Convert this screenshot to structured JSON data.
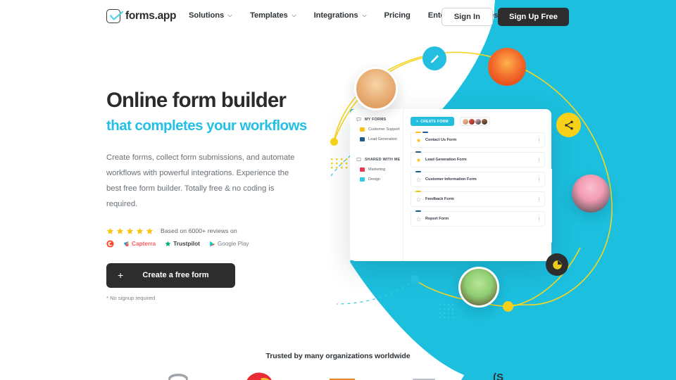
{
  "brand": {
    "name": "forms.app",
    "logo_icon": "form-check-icon",
    "accent_cyan": "#23C0E4",
    "accent_yellow": "#F7D117",
    "dark": "#2d2d2d"
  },
  "header": {
    "nav_items": [
      {
        "label": "Solutions",
        "has_dropdown": true,
        "icon": "chevron-down-icon"
      },
      {
        "label": "Templates",
        "has_dropdown": true,
        "icon": "chevron-down-icon"
      },
      {
        "label": "Integrations",
        "has_dropdown": true,
        "icon": "chevron-down-icon"
      },
      {
        "label": "Pricing",
        "has_dropdown": false,
        "icon": ""
      },
      {
        "label": "Enterprise",
        "has_dropdown": false,
        "icon": ""
      },
      {
        "label": "Resources",
        "has_dropdown": true,
        "icon": "chevron-down-icon"
      }
    ],
    "sign_in": "Sign In",
    "sign_up": "Sign Up Free"
  },
  "hero": {
    "title": "Online form builder",
    "subtitle": "that completes your workflows",
    "description": "Create forms, collect form submissions, and automate workflows with powerful integrations. Experience the best free form builder. Totally free & no coding is required.",
    "reviews_text": "Based on 6000+ reviews on",
    "stars": 5,
    "review_badges": [
      {
        "label": "G2",
        "icon": "g2-icon"
      },
      {
        "label": "Capterra",
        "icon": "capterra-icon"
      },
      {
        "label": "Trustpilot",
        "icon": "trustpilot-star-icon"
      },
      {
        "label": "Google Play",
        "icon": "google-play-icon"
      }
    ],
    "cta_label": "Create a free form",
    "cta_icon": "plus-icon",
    "cta_note": "* No signup required"
  },
  "mockup": {
    "sidebar": [
      {
        "section": "MY FORMS",
        "section_icon": "chat-bubble-icon",
        "items": [
          {
            "label": "Customer Support",
            "color": "#F9C116",
            "icon": "folder-icon"
          },
          {
            "label": "Lead Generation",
            "color": "#1C5D8C",
            "icon": "folder-icon"
          }
        ]
      },
      {
        "section": "SHARED WITH ME",
        "section_icon": "share-box-icon",
        "items": [
          {
            "label": "Marketing",
            "color": "#E8384F",
            "icon": "folder-icon"
          },
          {
            "label": "Design",
            "color": "#2ECAE8",
            "icon": "folder-icon"
          }
        ]
      }
    ],
    "create_button": "CREATE FORM",
    "create_icon": "plus-icon",
    "collaborators": [
      {
        "name": "avatar-collaborator-1",
        "color": "#E8A487"
      },
      {
        "name": "avatar-collaborator-2",
        "color": "#C0392B"
      },
      {
        "name": "avatar-collaborator-3",
        "color": "#E59BB0"
      },
      {
        "name": "avatar-collaborator-4",
        "color": "#8C5A3C"
      }
    ],
    "forms": [
      {
        "name": "Contact Us Form",
        "starred": true,
        "tags": [
          "#F9C116",
          "#1C5D8C"
        ],
        "menu_icon": "more-vertical-icon"
      },
      {
        "name": "Lead Generation Form",
        "starred": true,
        "tags": [
          "#1C5D8C"
        ],
        "menu_icon": "more-vertical-icon"
      },
      {
        "name": "Customer Information Form",
        "starred": false,
        "tags": [
          "#1C5D8C"
        ],
        "menu_icon": "more-vertical-icon"
      },
      {
        "name": "Feedback Form",
        "starred": false,
        "tags": [
          "#F9C116"
        ],
        "menu_icon": "more-vertical-icon"
      },
      {
        "name": "Report Form",
        "starred": false,
        "tags": [
          "#1C5D8C"
        ],
        "menu_icon": "more-vertical-icon"
      }
    ]
  },
  "decorations": {
    "floating_icons": [
      {
        "name": "edit-pencil-icon",
        "bg": "#23BEE0",
        "fg": "#ffffff"
      },
      {
        "name": "share-nodes-icon",
        "bg": "#F7D117",
        "fg": "#2d2d2d"
      },
      {
        "name": "pie-chart-icon",
        "bg": "#2d2d2d",
        "fg": "#F7D117"
      }
    ],
    "avatars": [
      {
        "name": "avatar-hero-woman-left",
        "bg": "#F3B96B"
      },
      {
        "name": "avatar-hero-child-orange",
        "bg": "#E8552A"
      },
      {
        "name": "avatar-hero-man-pink",
        "bg": "#F5A3B8"
      },
      {
        "name": "avatar-hero-woman-green",
        "bg": "#9CD17C"
      }
    ],
    "dots": [
      {
        "name": "yellow-dot-grid",
        "color": "#F7D117"
      },
      {
        "name": "cyan-dot-grid",
        "color": "#2ECAE8"
      }
    ]
  },
  "trusted": {
    "title": "Trusted by many organizations worldwide",
    "logos": [
      {
        "name": "client-logo-1"
      },
      {
        "name": "client-logo-2"
      },
      {
        "name": "client-logo-3"
      },
      {
        "name": "client-logo-4"
      },
      {
        "name": "client-logo-5"
      }
    ]
  }
}
